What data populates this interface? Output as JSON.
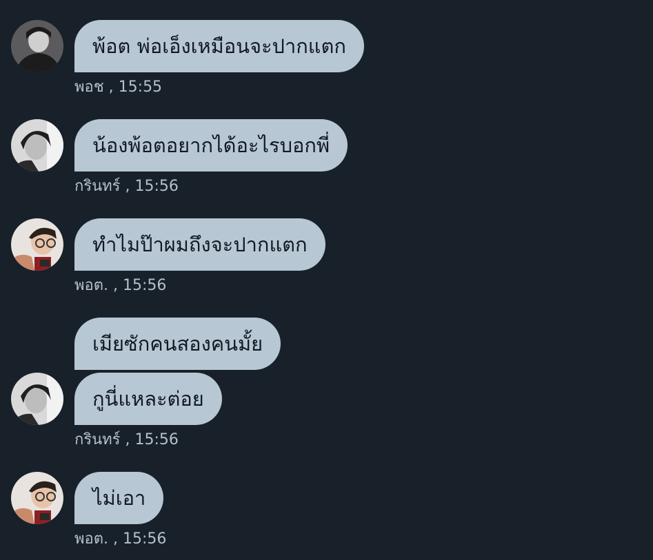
{
  "messages": [
    {
      "text": "พ้อต พ่อเอ็งเหมือนจะปากแตก",
      "sender": "พอช",
      "time": "15:55"
    },
    {
      "text": "น้องพ้อตอยากได้อะไรบอกพี่",
      "sender": "กรินทร์",
      "time": "15:56"
    },
    {
      "text": "ทำไมป๊าผมถึงจะปากแตก",
      "sender": "พอต.",
      "time": "15:56"
    },
    {
      "text": "เมียซักคนสองคนมั้ย"
    },
    {
      "text": "กูนี่แหละต่อย",
      "sender": "กรินทร์",
      "time": "15:56"
    },
    {
      "text": "ไม่เอา",
      "sender": "พอต.",
      "time": "15:56"
    }
  ],
  "meta_separator": ",",
  "colors": {
    "background": "#18202a",
    "bubble": "#b8c7d4",
    "bubble_text": "#111923",
    "meta_text": "#b4c0cc"
  }
}
